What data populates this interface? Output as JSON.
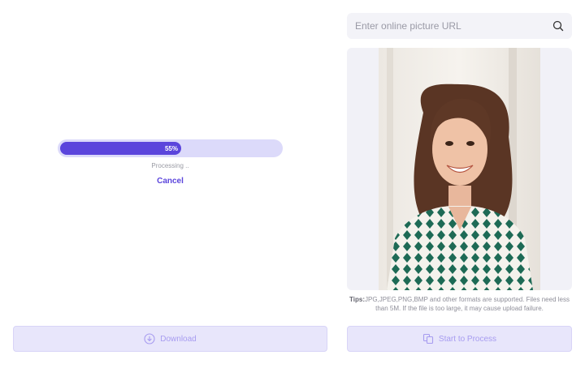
{
  "progress": {
    "percent_label": "55%",
    "fraction": 0.55,
    "status_text": "Processing ..",
    "cancel_label": "Cancel"
  },
  "url_input": {
    "placeholder": "Enter online picture URL",
    "value": ""
  },
  "icons": {
    "search": "search-icon",
    "download": "download-icon",
    "process": "copy-icon"
  },
  "tips": {
    "label": "Tips:",
    "text": "JPG,JPEG,PNG,BMP and other formats are supported. Files need less than 5M. If the file is too large, it may cause upload failure."
  },
  "buttons": {
    "download_label": "Download",
    "process_label": "Start to Process"
  },
  "colors": {
    "accent": "#5b45dc",
    "track": "#dcdafa",
    "button_bg": "#e8e6fb",
    "button_text": "#a79cf0"
  }
}
